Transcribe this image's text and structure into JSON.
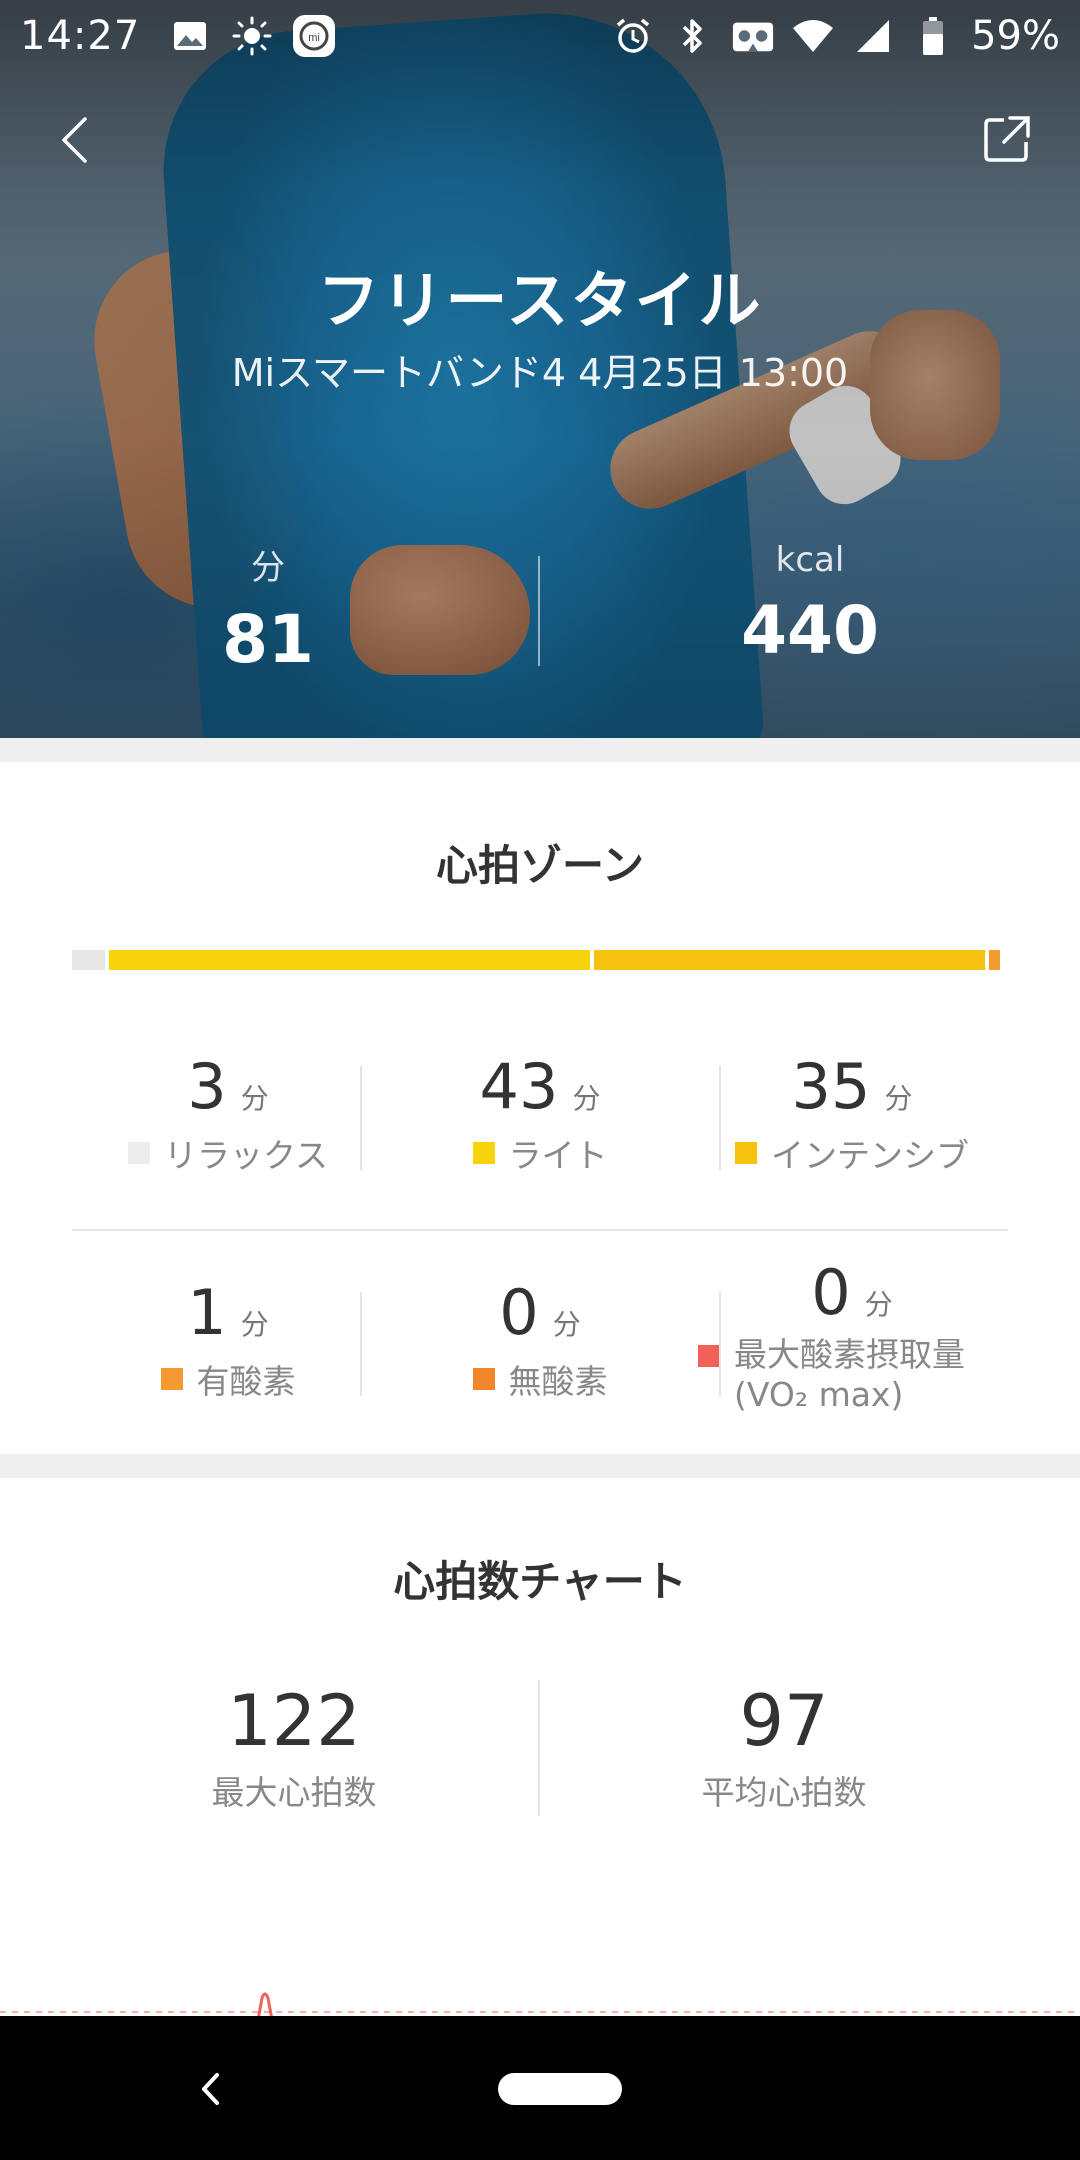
{
  "status_bar": {
    "time": "14:27",
    "battery": "59%",
    "icons": [
      "image-icon",
      "brightness-icon",
      "mi-icon",
      "alarm-icon",
      "bluetooth-icon",
      "vr-icon",
      "wifi-icon",
      "signal-icon",
      "battery-icon"
    ]
  },
  "header": {
    "title": "フリースタイル",
    "subtitle": "Miスマートバンド4 4月25日 13:00",
    "duration_unit": "分",
    "duration_value": "81",
    "calories_unit": "kcal",
    "calories_value": "440"
  },
  "heart_zone": {
    "title": "心拍ゾーン",
    "bar": [
      {
        "zone": "relax",
        "minutes": 3,
        "color": "#e8e8e8"
      },
      {
        "zone": "light",
        "minutes": 43,
        "color": "#f9d40c"
      },
      {
        "zone": "intensive",
        "minutes": 35,
        "color": "#f6c10f"
      },
      {
        "zone": "aerobic",
        "minutes": 1,
        "color": "#f59a30"
      },
      {
        "zone": "anaerobic",
        "minutes": 0,
        "color": "#f2862a"
      },
      {
        "zone": "vo2max",
        "minutes": 0,
        "color": "#f26058"
      }
    ],
    "unit": "分",
    "zones": [
      {
        "value": "3",
        "label": "リラックス",
        "color": "#ececec"
      },
      {
        "value": "43",
        "label": "ライト",
        "color": "#f9d40c"
      },
      {
        "value": "35",
        "label": "インテンシブ",
        "color": "#f6c10f"
      },
      {
        "value": "1",
        "label": "有酸素",
        "color": "#f59a30"
      },
      {
        "value": "0",
        "label": "無酸素",
        "color": "#f2862a"
      },
      {
        "value": "0",
        "label": "最大酸素摂取量 (VO₂ max)",
        "color": "#f26058"
      }
    ]
  },
  "heart_chart": {
    "title": "心拍数チャート",
    "max_value": "122",
    "max_label": "最大心拍数",
    "avg_value": "97",
    "avg_label": "平均心拍数",
    "line_color": "#f26058"
  }
}
